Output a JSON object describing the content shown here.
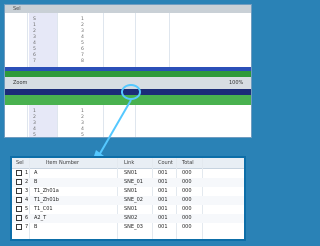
{
  "top_window": {
    "mid_left_label": "Zoom",
    "mid_right_label": "100%",
    "rows_left": [
      "S",
      "1",
      "2",
      "3",
      "4",
      "5",
      "6",
      "7"
    ],
    "rows_right": [
      "1",
      "2",
      "3",
      "4",
      "5",
      "6",
      "7",
      "8"
    ],
    "lower_rows_left": [
      "1",
      "2",
      "3",
      "4",
      "5"
    ],
    "lower_rows_right": [
      "1",
      "2",
      "3",
      "4",
      "5"
    ]
  },
  "zoom_panel": {
    "columns": [
      "Sel",
      "Item Number",
      "Link",
      "Count",
      "Total"
    ],
    "rows": [
      {
        "id": "1",
        "name": "A",
        "link": "SN01",
        "count": "001",
        "total": "000"
      },
      {
        "id": "2",
        "name": "B",
        "link": "SNE_01",
        "count": "001",
        "total": "000"
      },
      {
        "id": "3",
        "name": "T1_Zh01a",
        "link": "SN01",
        "count": "001",
        "total": "000"
      },
      {
        "id": "4",
        "name": "T1_Zh01b",
        "link": "SNE_02",
        "count": "001",
        "total": "000"
      },
      {
        "id": "5",
        "name": "T1_C01",
        "link": "SN01",
        "count": "001",
        "total": "000"
      },
      {
        "id": "6",
        "name": "A2_T",
        "link": "SN02",
        "count": "001",
        "total": "000"
      },
      {
        "id": "7",
        "name": "B",
        "link": "SNE_03",
        "count": "001",
        "total": "000"
      }
    ]
  },
  "colors": {
    "frame_bg": "#2a82b6",
    "highlight_ring": "#55c8ff",
    "panel_border": "#0d6ea8",
    "green_bar": "#2f9a3a",
    "navy_bar": "#1b2c78"
  }
}
